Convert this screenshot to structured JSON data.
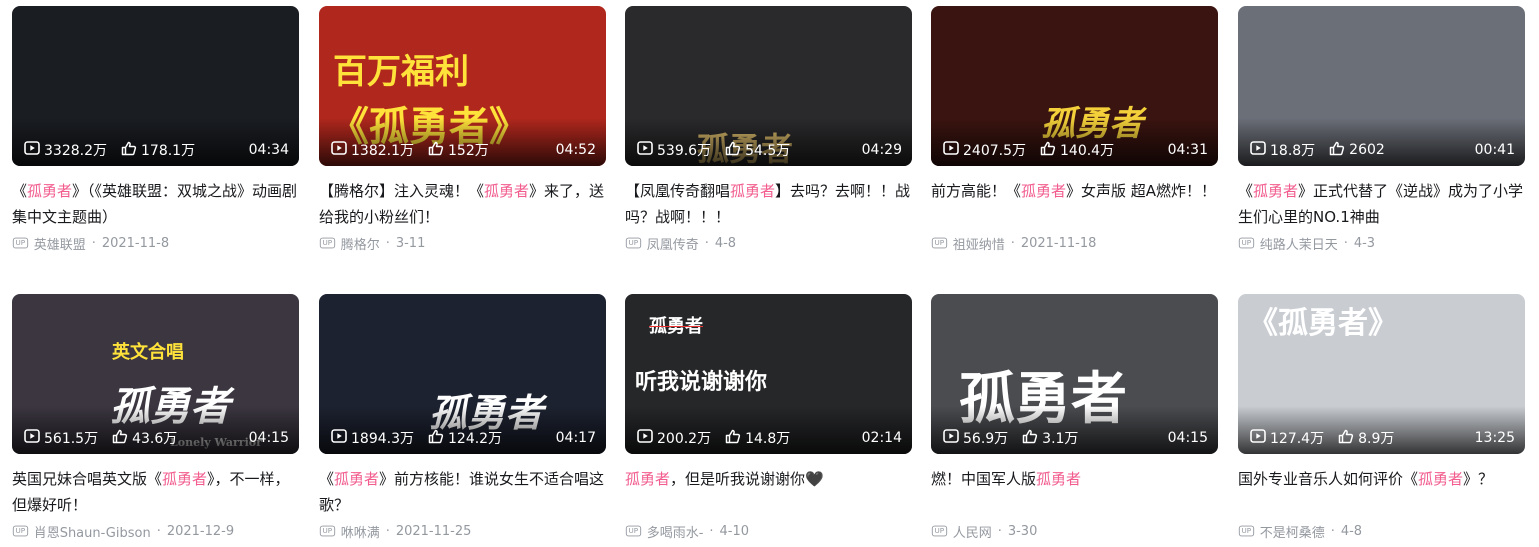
{
  "videos": [
    {
      "views": "3328.2万",
      "likes": "178.1万",
      "duration": "04:34",
      "title_pre": "《",
      "title_hl": "孤勇者",
      "title_post": "》（《英雄联盟：双城之战》动画剧集中文主题曲）",
      "author": "英雄联盟",
      "date": "2021-11-8",
      "thumb_color": "#1a1d22"
    },
    {
      "views": "1382.1万",
      "likes": "152万",
      "duration": "04:52",
      "title_pre": "【腾格尔】注入灵魂！《",
      "title_hl": "孤勇者",
      "title_post": "》来了，送给我的小粉丝们！",
      "author": "腾格尔",
      "date": "3-11",
      "thumb_color": "#b0271d",
      "art_top": "百万福利",
      "art_main": "《孤勇者》"
    },
    {
      "views": "539.6万",
      "likes": "54.5万",
      "duration": "04:29",
      "title_pre": "【凤凰传奇翻唱",
      "title_hl": "孤勇者",
      "title_post": "】去吗？去啊！！战吗？战啊！！！",
      "author": "凤凰传奇",
      "date": "4-8",
      "thumb_color": "#2a2a2c",
      "art_main": "孤勇者"
    },
    {
      "views": "2407.5万",
      "likes": "140.4万",
      "duration": "04:31",
      "title_pre": "前方高能！《",
      "title_hl": "孤勇者",
      "title_post": "》女声版 超A燃炸！！",
      "author": "祖娅纳惜",
      "date": "2021-11-18",
      "thumb_color": "#3a1410",
      "art_main": "孤勇者"
    },
    {
      "views": "18.8万",
      "likes": "2602",
      "duration": "00:41",
      "title_pre": "《",
      "title_hl": "孤勇者",
      "title_post": "》正式代替了《逆战》成为了小学生们心里的NO.1神曲",
      "author": "纯路人茉日天",
      "date": "4-3",
      "thumb_color": "#6b6f78"
    },
    {
      "views": "561.5万",
      "likes": "43.6万",
      "duration": "04:15",
      "title_pre": "英国兄妹合唱英文版《",
      "title_hl": "孤勇者",
      "title_post": "》，不一样，但爆好听！",
      "author": "肖恩Shaun-Gibson",
      "date": "2021-12-9",
      "thumb_color": "#3b3640",
      "art_top": "英文合唱",
      "art_main": "孤勇者",
      "art_sub": "Lonely Warrior"
    },
    {
      "views": "1894.3万",
      "likes": "124.2万",
      "duration": "04:17",
      "title_pre": "《",
      "title_hl": "孤勇者",
      "title_post": "》前方核能！谁说女生不适合唱这歌？",
      "author": "咻咻满",
      "date": "2021-11-25",
      "thumb_color": "#1d2230",
      "art_main": "孤勇者"
    },
    {
      "views": "200.2万",
      "likes": "14.8万",
      "duration": "02:14",
      "title_pre": "",
      "title_hl": "孤勇者",
      "title_post": "，但是听我说谢谢你🖤",
      "author": "多喝雨水-",
      "date": "4-10",
      "thumb_color": "#262729",
      "art_top": "孤勇者",
      "art_main": "听我说谢谢你"
    },
    {
      "views": "56.9万",
      "likes": "3.1万",
      "duration": "04:15",
      "title_pre": "燃！中国军人版",
      "title_hl": "孤勇者",
      "title_post": "",
      "author": "人民网",
      "date": "3-30",
      "thumb_color": "#4a4c50",
      "art_main": "孤勇者"
    },
    {
      "views": "127.4万",
      "likes": "8.9万",
      "duration": "13:25",
      "title_pre": "国外专业音乐人如何评价《",
      "title_hl": "孤勇者",
      "title_post": "》？",
      "author": "不是柯桑德",
      "date": "4-8",
      "thumb_color": "#c9cdd2",
      "art_main": "《孤勇者》"
    }
  ]
}
